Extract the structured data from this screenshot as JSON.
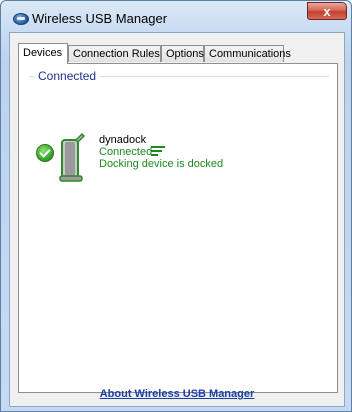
{
  "window": {
    "title": "Wireless USB Manager",
    "close_label": "x"
  },
  "tabs": [
    {
      "label": "Devices"
    },
    {
      "label": "Connection Rules"
    },
    {
      "label": "Options"
    },
    {
      "label": "Communications"
    }
  ],
  "devices_panel": {
    "group_label": "Connected",
    "device": {
      "name": "dynadock",
      "status": "Connected",
      "detail": "Docking device is docked",
      "status_color": "#1c8a1c"
    }
  },
  "footer": {
    "about_link": "About Wireless USB Manager"
  },
  "icons": {
    "app": "wusb-icon",
    "status": "check-icon",
    "device": "dock-icon",
    "signal": "signal-icon"
  }
}
